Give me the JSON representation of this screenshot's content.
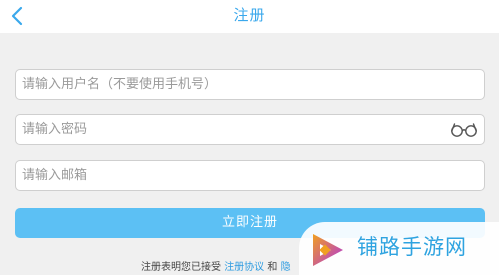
{
  "navbar": {
    "title": "注册",
    "back_icon": "chevron-left-icon"
  },
  "form": {
    "username": {
      "placeholder": "请输入用户名（不要使用手机号）",
      "value": ""
    },
    "password": {
      "placeholder": "请输入密码",
      "value": "",
      "toggle_icon": "glasses-icon"
    },
    "email": {
      "placeholder": "请输入邮箱",
      "value": ""
    },
    "submit_label": "立即注册"
  },
  "agreement": {
    "prefix": "注册表明您已接受",
    "terms_link": "注册协议",
    "conjunction": "和",
    "privacy_link_partial": "隐"
  },
  "watermark": {
    "text": "铺路手游网",
    "logo_icon": "play-arrow-logo"
  },
  "colors": {
    "accent": "#3aa8ec",
    "button": "#5cc0f4",
    "background": "#f0f0f0",
    "logo_orange": "#f0a020",
    "logo_purple": "#b030e0"
  }
}
